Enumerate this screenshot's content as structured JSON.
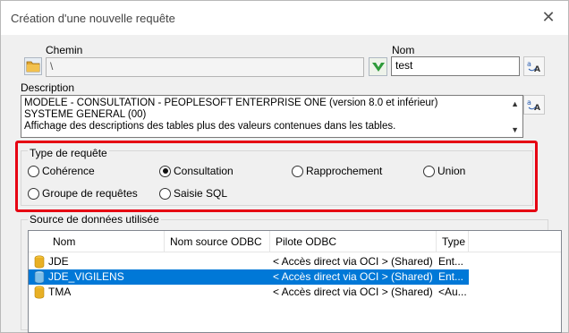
{
  "window": {
    "title": "Création d'une nouvelle requête"
  },
  "path": {
    "label": "Chemin",
    "value": "\\"
  },
  "name": {
    "label": "Nom",
    "value": "test"
  },
  "description": {
    "label": "Description",
    "lines": [
      "MODELE - CONSULTATION - PEOPLESOFT ENTERPRISE ONE (version 8.0 et inférieur)",
      "SYSTEME GENERAL (00)",
      "Affichage des descriptions des tables plus des valeurs contenues dans les tables."
    ]
  },
  "query_type": {
    "label": "Type de requête",
    "options": [
      "Cohérence",
      "Consultation",
      "Rapprochement",
      "Union",
      "Groupe de requêtes",
      "Saisie SQL"
    ],
    "selected": "Consultation"
  },
  "data_source": {
    "label": "Source de données utilisée",
    "columns": [
      "Nom",
      "Nom source ODBC",
      "Pilote ODBC",
      "Type"
    ],
    "rows": [
      {
        "name": "JDE",
        "odbc_source": "",
        "driver": "< Accès direct via OCI > (Shared)",
        "type": "Ent...",
        "selected": false
      },
      {
        "name": "JDE_VIGILENS",
        "odbc_source": "",
        "driver": "< Accès direct via OCI > (Shared)",
        "type": "Ent...",
        "selected": true
      },
      {
        "name": "TMA",
        "odbc_source": "",
        "driver": "< Accès direct via OCI > (Shared)",
        "type": "<Au...",
        "selected": false
      }
    ]
  },
  "colors": {
    "highlight": "#e60012",
    "selection": "#0078d7",
    "check": "#2e9b3a"
  },
  "icons": [
    "folder-icon",
    "checkmark-icon",
    "translate-icon",
    "close-icon",
    "database-icon"
  ]
}
